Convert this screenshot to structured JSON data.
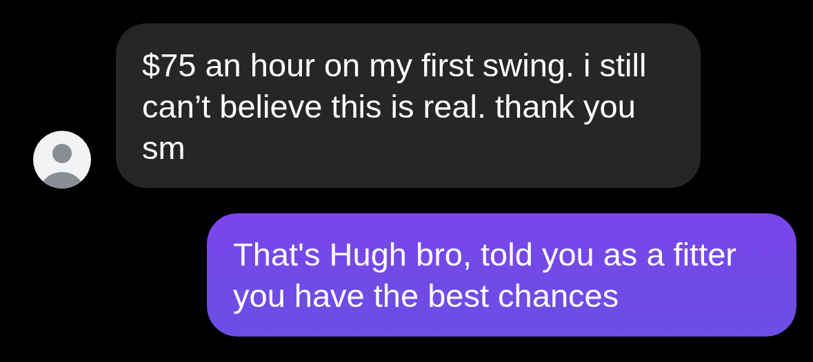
{
  "messages": [
    {
      "kind": "incoming",
      "text": "$75 an hour on my first swing. i still can’t believe this is real. thank you sm"
    },
    {
      "kind": "outgoing",
      "text": "That's Hugh bro, told you as a fitter you have the best chances"
    }
  ]
}
